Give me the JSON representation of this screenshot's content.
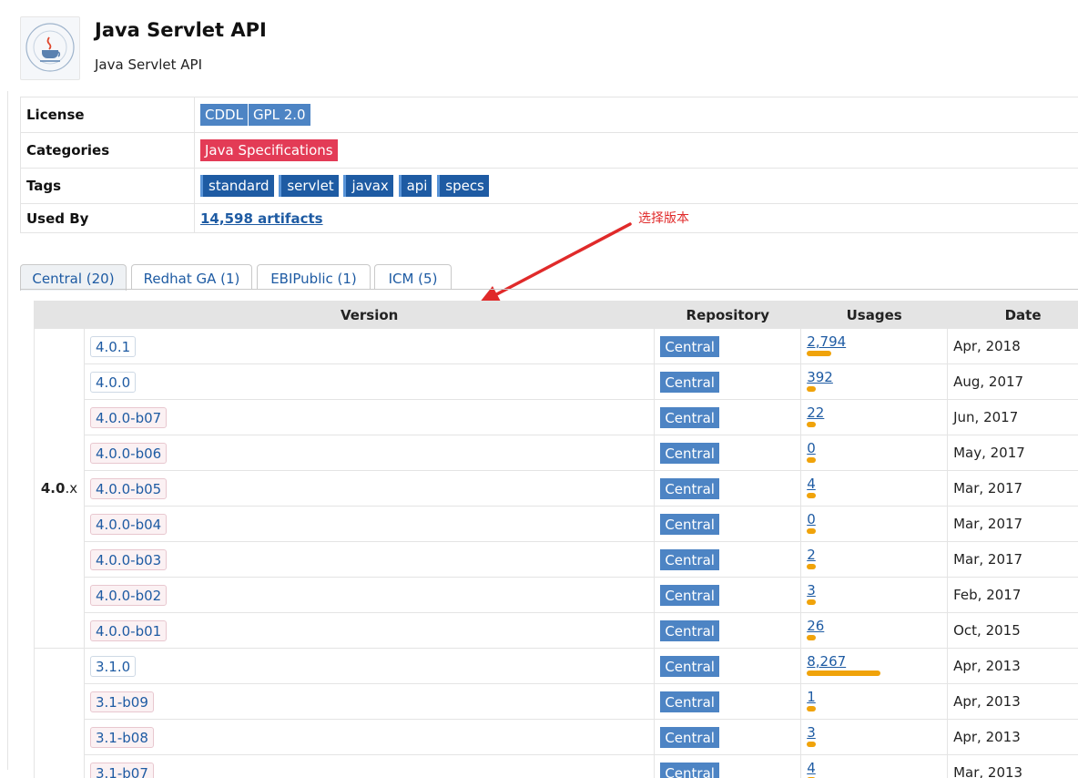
{
  "header": {
    "title": "Java Servlet API",
    "subtitle": "Java Servlet API"
  },
  "info": {
    "license_label": "License",
    "licenses": [
      "CDDL",
      "GPL 2.0"
    ],
    "categories_label": "Categories",
    "categories": [
      "Java Specifications"
    ],
    "tags_label": "Tags",
    "tags": [
      "standard",
      "servlet",
      "javax",
      "api",
      "specs"
    ],
    "used_by_label": "Used By",
    "used_by_value": "14,598 artifacts"
  },
  "annotation": {
    "text": "选择版本",
    "color": "#e02a2a"
  },
  "tabs": [
    {
      "label": "Central (20)",
      "active": true
    },
    {
      "label": "Redhat GA (1)",
      "active": false
    },
    {
      "label": "EBIPublic (1)",
      "active": false
    },
    {
      "label": "ICM (5)",
      "active": false
    }
  ],
  "table": {
    "headers": {
      "version": "Version",
      "repository": "Repository",
      "usages": "Usages",
      "date": "Date"
    },
    "groups": [
      {
        "label_bold": "4.0",
        "label_rest": ".x"
      },
      {
        "label_bold": "",
        "label_rest": ""
      }
    ],
    "rows": [
      {
        "version": "4.0.1",
        "prerelease": false,
        "repo": "Central",
        "usages": "2,794",
        "usage_count": 2794,
        "date": "Apr, 2018"
      },
      {
        "version": "4.0.0",
        "prerelease": false,
        "repo": "Central",
        "usages": "392",
        "usage_count": 392,
        "date": "Aug, 2017"
      },
      {
        "version": "4.0.0-b07",
        "prerelease": true,
        "repo": "Central",
        "usages": "22",
        "usage_count": 22,
        "date": "Jun, 2017"
      },
      {
        "version": "4.0.0-b06",
        "prerelease": true,
        "repo": "Central",
        "usages": "0",
        "usage_count": 0,
        "date": "May, 2017"
      },
      {
        "version": "4.0.0-b05",
        "prerelease": true,
        "repo": "Central",
        "usages": "4",
        "usage_count": 4,
        "date": "Mar, 2017"
      },
      {
        "version": "4.0.0-b04",
        "prerelease": true,
        "repo": "Central",
        "usages": "0",
        "usage_count": 0,
        "date": "Mar, 2017"
      },
      {
        "version": "4.0.0-b03",
        "prerelease": true,
        "repo": "Central",
        "usages": "2",
        "usage_count": 2,
        "date": "Mar, 2017"
      },
      {
        "version": "4.0.0-b02",
        "prerelease": true,
        "repo": "Central",
        "usages": "3",
        "usage_count": 3,
        "date": "Feb, 2017"
      },
      {
        "version": "4.0.0-b01",
        "prerelease": true,
        "repo": "Central",
        "usages": "26",
        "usage_count": 26,
        "date": "Oct, 2015"
      },
      {
        "version": "3.1.0",
        "prerelease": false,
        "repo": "Central",
        "usages": "8,267",
        "usage_count": 8267,
        "date": "Apr, 2013"
      },
      {
        "version": "3.1-b09",
        "prerelease": true,
        "repo": "Central",
        "usages": "1",
        "usage_count": 1,
        "date": "Apr, 2013"
      },
      {
        "version": "3.1-b08",
        "prerelease": true,
        "repo": "Central",
        "usages": "3",
        "usage_count": 3,
        "date": "Apr, 2013"
      },
      {
        "version": "3.1-b07",
        "prerelease": true,
        "repo": "Central",
        "usages": "4",
        "usage_count": 4,
        "date": "Mar, 2013"
      }
    ]
  },
  "colors": {
    "license_chip": "#4d84c4",
    "category_chip": "#e33b56",
    "tag_chip": "#1e5ba3",
    "repo_badge": "#4d84c4",
    "usage_bar": "#f0a30a",
    "link": "#1e5ba3"
  }
}
